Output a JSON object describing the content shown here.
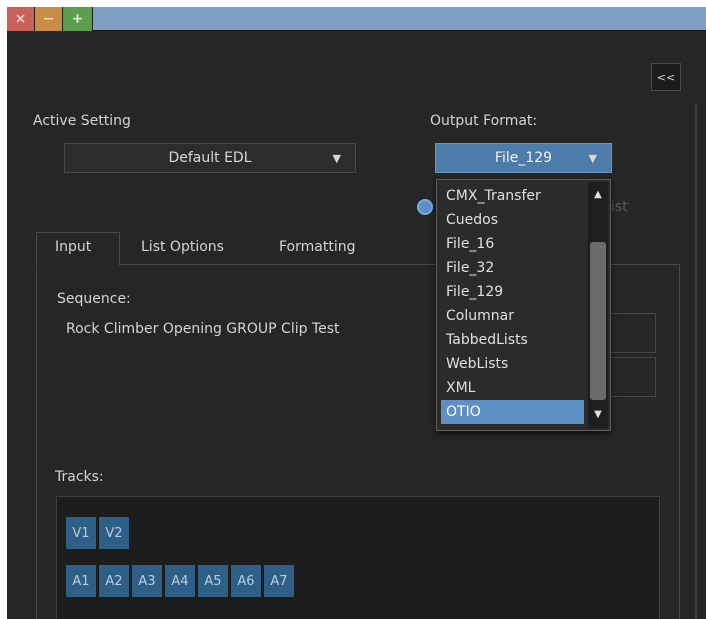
{
  "titlebar": {
    "close_icon": "×",
    "minimize_icon": "−",
    "maximize_icon": "+"
  },
  "collapse_label": "<<",
  "active_setting": {
    "label": "Active Setting",
    "value": "Default EDL",
    "arrow": "▼"
  },
  "output_format": {
    "label": "Output Format:",
    "value": "File_129",
    "arrow": "▼"
  },
  "behind_text": "ist",
  "tabs": [
    {
      "label": "Input"
    },
    {
      "label": "List Options"
    },
    {
      "label": "Formatting"
    }
  ],
  "sequence": {
    "label": "Sequence:",
    "value": "Rock Climber Opening GROUP Clip Test"
  },
  "tracks": {
    "label": "Tracks:",
    "video": [
      "V1",
      "V2"
    ],
    "audio": [
      "A1",
      "A2",
      "A3",
      "A4",
      "A5",
      "A6",
      "A7"
    ]
  },
  "dropdown": {
    "options": [
      "CMX_Transfer",
      "Cuedos",
      "File_16",
      "File_32",
      "File_129",
      "Columnar",
      "TabbedLists",
      "WebLists",
      "XML",
      "OTIO"
    ],
    "highlighted": "OTIO",
    "scroll_up": "▲",
    "scroll_down": "▼"
  }
}
